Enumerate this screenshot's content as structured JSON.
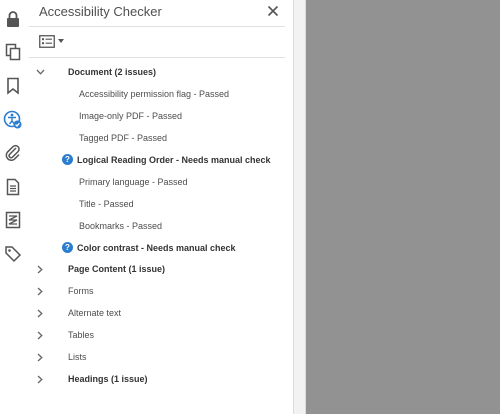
{
  "panel": {
    "title": "Accessibility Checker"
  },
  "colors": {
    "accent": "#2c7dd0",
    "workspace": "#929292",
    "icon": "#555555"
  },
  "toolrail": [
    {
      "name": "lock-icon"
    },
    {
      "name": "pages-icon"
    },
    {
      "name": "bookmark-icon"
    },
    {
      "name": "accessibility-icon"
    },
    {
      "name": "attachment-icon"
    },
    {
      "name": "document-icon"
    },
    {
      "name": "order-icon"
    },
    {
      "name": "tags-icon"
    }
  ],
  "tree": [
    {
      "label": "Document (2 issues)",
      "bold": true,
      "expanded": true,
      "level": 0
    },
    {
      "label": "Accessibility permission flag - Passed",
      "level": 2
    },
    {
      "label": "Image-only PDF - Passed",
      "level": 2
    },
    {
      "label": "Tagged PDF - Passed",
      "level": 2
    },
    {
      "label": "Logical Reading Order - Needs manual check",
      "bold": true,
      "status": "help",
      "level": 1
    },
    {
      "label": "Primary language - Passed",
      "level": 2
    },
    {
      "label": "Title - Passed",
      "level": 2
    },
    {
      "label": "Bookmarks - Passed",
      "level": 2
    },
    {
      "label": "Color contrast - Needs manual check",
      "bold": true,
      "status": "help",
      "level": 1
    },
    {
      "label": "Page Content (1 issue)",
      "bold": true,
      "expanded": false,
      "level": 0
    },
    {
      "label": "Forms",
      "expanded": false,
      "level": 0
    },
    {
      "label": "Alternate text",
      "expanded": false,
      "level": 0
    },
    {
      "label": "Tables",
      "expanded": false,
      "level": 0
    },
    {
      "label": "Lists",
      "expanded": false,
      "level": 0
    },
    {
      "label": "Headings (1 issue)",
      "bold": true,
      "expanded": false,
      "level": 0
    }
  ]
}
